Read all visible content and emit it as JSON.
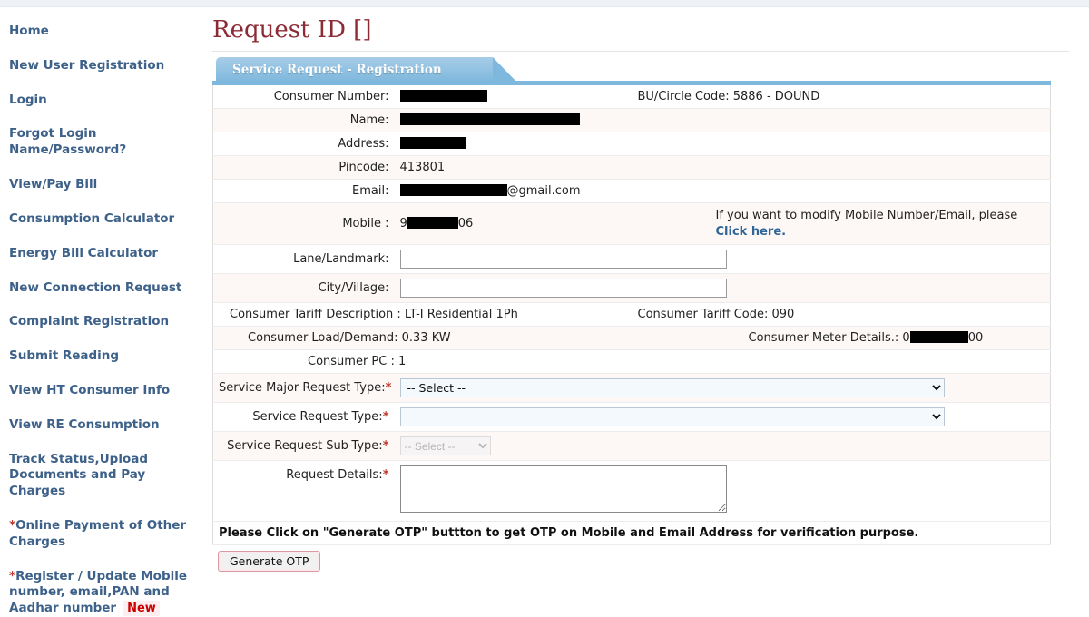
{
  "sidebar": {
    "items": [
      {
        "label": "Home",
        "star": false,
        "badge": null
      },
      {
        "label": "New User Registration",
        "star": false,
        "badge": null
      },
      {
        "label": "Login",
        "star": false,
        "badge": null
      },
      {
        "label": "Forgot Login Name/Password?",
        "star": false,
        "badge": null
      },
      {
        "label": "View/Pay Bill",
        "star": false,
        "badge": null
      },
      {
        "label": "Consumption Calculator",
        "star": false,
        "badge": null
      },
      {
        "label": "Energy Bill Calculator",
        "star": false,
        "badge": null
      },
      {
        "label": "New Connection Request",
        "star": false,
        "badge": null
      },
      {
        "label": "Complaint Registration",
        "star": false,
        "badge": null
      },
      {
        "label": "Submit Reading",
        "star": false,
        "badge": null
      },
      {
        "label": "View HT Consumer Info",
        "star": false,
        "badge": null
      },
      {
        "label": "View RE Consumption",
        "star": false,
        "badge": null
      },
      {
        "label": "Track Status,Upload Documents and Pay Charges",
        "star": false,
        "badge": null
      },
      {
        "label": "Online Payment of Other Charges",
        "star": true,
        "badge": null
      },
      {
        "label": "Register / Update Mobile number, email,PAN and Aadhar number",
        "star": true,
        "badge": "New"
      }
    ]
  },
  "header": {
    "title": "Request ID []"
  },
  "panel": {
    "tab_label": "Service Request - Registration"
  },
  "form": {
    "consumer_number_label": "Consumer Number:",
    "consumer_number_value": "",
    "bu_circle_label": "BU/Circle Code: 5886 - DOUND",
    "name_label": "Name:",
    "name_value": "",
    "address_label": "Address:",
    "address_value": "",
    "pincode_label": "Pincode:",
    "pincode_value": "413801",
    "email_label": "Email:",
    "email_value": "@gmail.com",
    "mobile_label": "Mobile :",
    "mobile_prefix": "9",
    "mobile_suffix": "06",
    "modify_note": "If you want to modify Mobile Number/Email, please",
    "modify_link": "Click here.",
    "lane_label": "Lane/Landmark:",
    "lane_value": "",
    "city_label": "City/Village:",
    "city_value": "",
    "tariff_desc_label": "Consumer Tariff Description : LT-I Residential 1Ph",
    "tariff_code_label": "Consumer Tariff Code: 090",
    "load_label": "Consumer Load/Demand: 0.33 KW",
    "meter_label_prefix": "Consumer Meter Details.: 0",
    "meter_label_suffix": "00",
    "pc_label": "Consumer PC : 1",
    "major_type_label": "Service Major Request Type:",
    "major_type_value": "-- Select --",
    "request_type_label": "Service Request Type:",
    "request_type_value": "",
    "sub_type_label": "Service Request Sub-Type:",
    "sub_type_value": "-- Select --",
    "details_label": "Request Details:",
    "details_value": "",
    "required_marker": "*",
    "otp_note": "Please Click on \"Generate OTP\" buttton to get OTP on Mobile and Email Address for verification purpose.",
    "otp_button": "Generate OTP"
  },
  "colors": {
    "title": "#8c2b35",
    "nav_link": "#3d6189",
    "tab_blue": "#7fb8dd",
    "required_red": "#c0392b",
    "badge_red": "#cc0000"
  }
}
